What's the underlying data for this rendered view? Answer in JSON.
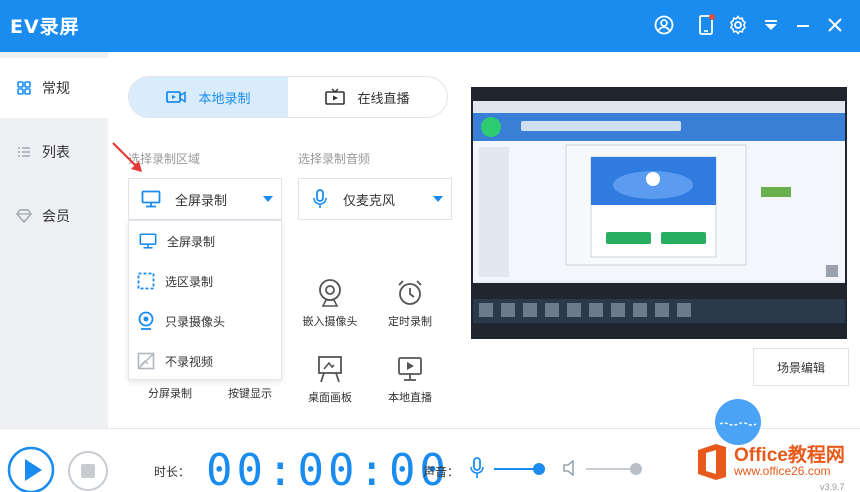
{
  "app": {
    "title": "EV录屏"
  },
  "sidebar": {
    "items": [
      {
        "label": "常规",
        "icon": "grid-icon",
        "active": true
      },
      {
        "label": "列表",
        "icon": "list-icon",
        "active": false
      },
      {
        "label": "会员",
        "icon": "diamond-icon",
        "active": false
      }
    ]
  },
  "main": {
    "tabs": [
      {
        "label": "本地录制",
        "icon": "record-icon",
        "active": true
      },
      {
        "label": "在线直播",
        "icon": "tv-icon",
        "active": false
      }
    ],
    "record_area_label": "选择录制区域",
    "record_audio_label": "选择录制音频",
    "area_select": {
      "value": "全屏录制",
      "icon": "monitor-icon"
    },
    "audio_select": {
      "value": "仅麦克风",
      "icon": "microphone-icon"
    },
    "area_options": [
      {
        "label": "全屏录制",
        "icon": "monitor-icon"
      },
      {
        "label": "选区录制",
        "icon": "selection-icon"
      },
      {
        "label": "只录摄像头",
        "icon": "camera-icon"
      },
      {
        "label": "不录视频",
        "icon": "no-video-icon"
      }
    ],
    "tools": [
      {
        "label": "嵌入摄像头",
        "icon": "webcam-icon"
      },
      {
        "label": "定时录制",
        "icon": "alarm-icon"
      },
      {
        "label": "分屏录制",
        "icon": "split-icon"
      },
      {
        "label": "按键显示",
        "icon": "keyboard-icon"
      },
      {
        "label": "桌面画板",
        "icon": "easel-icon"
      },
      {
        "label": "本地直播",
        "icon": "live-icon"
      }
    ],
    "scene_edit_label": "场景编辑"
  },
  "bottom": {
    "duration_label": "时长：",
    "timer": "00:00:00",
    "sound_label": "声音：",
    "mic_volume": 0.9,
    "speaker_volume": 1.0
  },
  "watermark": {
    "brand": "Office教程网",
    "url": "www.office26.com"
  },
  "version": "v3.9.7",
  "colors": {
    "accent": "#1a8cf0",
    "sidebar_bg": "#eef0f3",
    "watermark": "#e85a1c"
  }
}
